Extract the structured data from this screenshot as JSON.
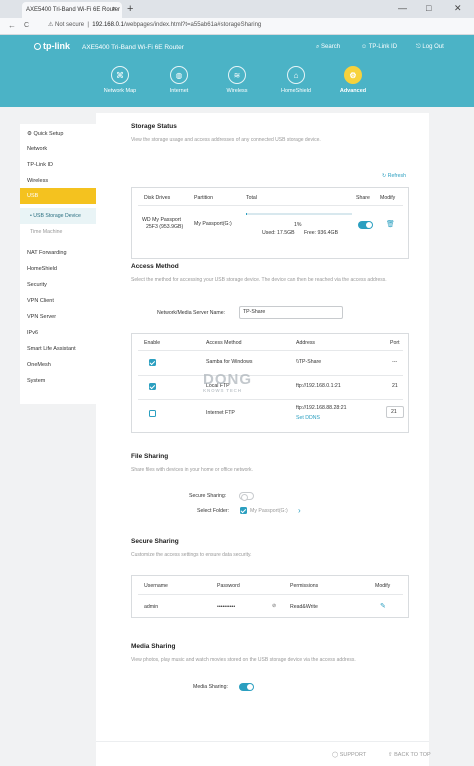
{
  "browser": {
    "tab_title": "AXE5400 Tri-Band Wi-Fi 6E Router",
    "tab_close": "×",
    "new_tab": "+",
    "window_min": "—",
    "window_max": "□",
    "window_close": "✕",
    "back": "←",
    "reload": "C",
    "security": "Not secure",
    "url_host": "192.168.0.1",
    "url_path": "/webpages/index.html?t=a55ab61a#storageSharing"
  },
  "header": {
    "brand": "tp-link",
    "product": "AXE5400 Tri-Band Wi-Fi 6E Router",
    "search": "Search",
    "tplink_id": "TP-Link ID",
    "logout": "Log Out",
    "nav": [
      {
        "label": "Network Map",
        "icon": "network-map-icon"
      },
      {
        "label": "Internet",
        "icon": "globe-icon"
      },
      {
        "label": "Wireless",
        "icon": "wifi-icon"
      },
      {
        "label": "HomeShield",
        "icon": "home-shield-icon"
      },
      {
        "label": "Advanced",
        "icon": "gear-icon",
        "active": true
      }
    ]
  },
  "sidebar": {
    "items": [
      "Quick Setup",
      "Network",
      "TP-Link ID",
      "Wireless",
      "USB",
      "USB Storage Device",
      "Time Machine",
      "NAT Forwarding",
      "HomeShield",
      "Security",
      "VPN Client",
      "VPN Server",
      "IPv6",
      "Smart Life Assistant",
      "OneMesh",
      "System"
    ]
  },
  "storage": {
    "title": "Storage Status",
    "desc": "View the storage usage and access addresses of any connected USB storage device.",
    "refresh": "Refresh",
    "headers": [
      "Disk Drives",
      "Partition",
      "Total",
      "Share",
      "Modify"
    ],
    "row": {
      "disk_line1": "WD My Passport",
      "disk_line2": "25F3 (953.9GB)",
      "partition": "My Passport(G:)",
      "percent": "1%",
      "used": "Used: 17.5GB",
      "free": "Free: 936.4GB",
      "usage_fraction": 0.01
    }
  },
  "access": {
    "title": "Access Method",
    "desc": "Select the method for accessing your USB storage device. The device can then be reached via the access address.",
    "server_name_label": "Network/Media Server Name:",
    "server_name_value": "TP-Share",
    "headers": [
      "Enable",
      "Access Method",
      "Address",
      "Port"
    ],
    "rows": [
      {
        "enabled": true,
        "method": "Samba for Windows",
        "address": "\\\\TP-Share",
        "port": "---"
      },
      {
        "enabled": true,
        "method": "Local FTP",
        "address": "ftp://192.168.0.1:21",
        "port": "21"
      },
      {
        "enabled": false,
        "method": "Internet FTP",
        "address": "ftp://192.168.88.28:21",
        "port": "21",
        "extra_link": "Set DDNS"
      }
    ]
  },
  "watermark": {
    "big": "DONG",
    "small": "KNOWS TECH"
  },
  "file_sharing": {
    "title": "File Sharing",
    "desc": "Share files with devices in your home or office network.",
    "secure_label": "Secure Sharing:",
    "secure_on": false,
    "folder_label": "Select Folder:",
    "folder_value": "My Passport(G:)"
  },
  "secure_sharing": {
    "title": "Secure Sharing",
    "desc": "Customize the access settings to ensure data security.",
    "headers": [
      "Username",
      "Password",
      "Permissions",
      "Modify"
    ],
    "row": {
      "username": "admin",
      "password": "••••••••••",
      "permissions": "Read&Write"
    }
  },
  "media_sharing": {
    "title": "Media Sharing",
    "desc": "View photos, play music and watch movies stored on the USB storage device via the access address.",
    "label": "Media Sharing:",
    "on": true
  },
  "footer": {
    "support": "SUPPORT",
    "back_to_top": "BACK TO TOP"
  },
  "colors": {
    "header": "#4bb3c6",
    "accent": "#2b9fc0",
    "usb_active": "#f4c21f",
    "advanced_icon": "#f7d23c"
  }
}
